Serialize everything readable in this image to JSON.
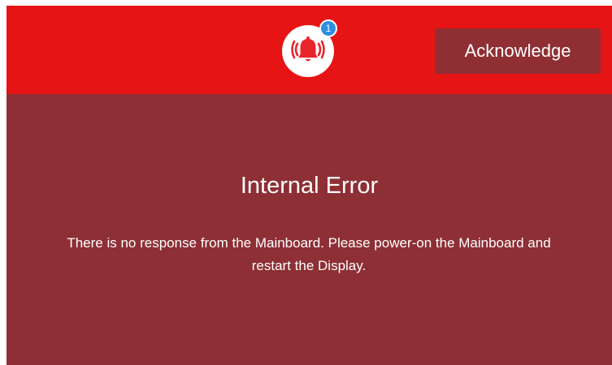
{
  "alarm": {
    "icon": "alarm-bell-icon",
    "badge_count": "1"
  },
  "header": {
    "acknowledge_label": "Acknowledge"
  },
  "error": {
    "title": "Internal Error",
    "message": "There is no response from the Mainboard. Please power-on the Mainboard and restart the Display."
  },
  "colors": {
    "header_red": "#e61414",
    "panel_dark_red": "#8d2f35",
    "bell_red": "#e8252a",
    "badge_blue": "#2f8fe0"
  }
}
